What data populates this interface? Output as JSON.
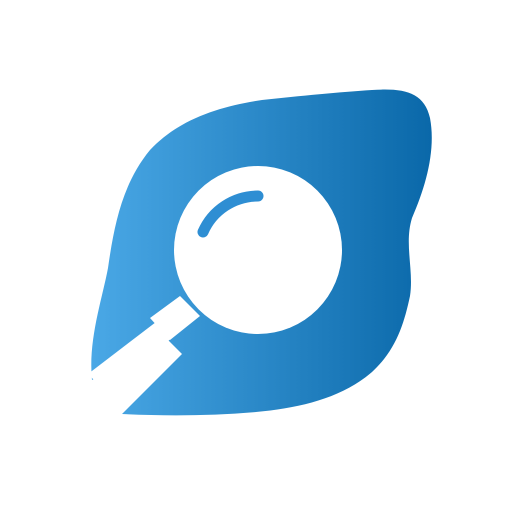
{
  "icon": {
    "name": "magnifier-app-icon",
    "description_colors": {
      "blob_gradient_start": "#4aa8e6",
      "blob_gradient_end": "#0a68a9",
      "lens_fill": "#ffffff",
      "lens_highlight": "#2e8ed3",
      "background": "#ffffff"
    }
  }
}
